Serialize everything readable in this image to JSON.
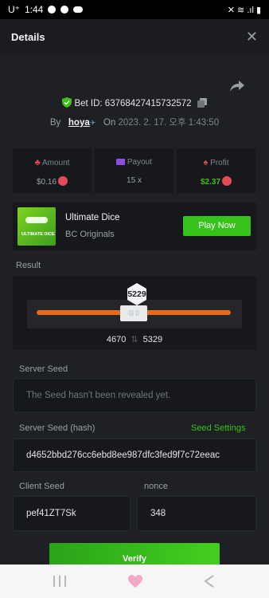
{
  "status_bar": {
    "carrier": "U⁺",
    "time": "1:44",
    "indicators": "✕ ≋ .ıl ▮"
  },
  "header": {
    "title": "Details",
    "close_icon": "close-icon"
  },
  "bet": {
    "id_label": "Bet ID: 63768427415732572",
    "by_label": "By",
    "user": "hoya",
    "on_label": "On",
    "date": "2023. 2. 17. 오후 1:43:50"
  },
  "stats": {
    "amount": {
      "label": "Amount",
      "value": "$0.16"
    },
    "payout": {
      "label": "Payout",
      "value": "15 x"
    },
    "profit": {
      "label": "Profit",
      "value": "$2.37"
    }
  },
  "game": {
    "name": "Ultimate Dice",
    "provider": "BC Originals",
    "thumb_text": "ULTIMATE DICE",
    "play_label": "Play Now"
  },
  "result": {
    "label": "Result",
    "roll": "5229",
    "range_low": "4670",
    "range_high": "5329",
    "handle_text": "⟨|| |⟩"
  },
  "server_seed": {
    "label": "Server Seed",
    "placeholder": "The Seed hasn't been revealed yet."
  },
  "server_seed_hash": {
    "label": "Server Seed (hash)",
    "settings_label": "Seed Settings",
    "value": "d4652bbd276cc6ebd8ee987dfc3fed9f7c72eeac"
  },
  "client_seed": {
    "label": "Client Seed",
    "value": "pef41ZT7Sk"
  },
  "nonce": {
    "label": "nonce",
    "value": "348"
  },
  "verify_label": "Verify",
  "colors": {
    "accent_green": "#37c21c",
    "result_orange": "#ea6a1c",
    "coin_red": "#e04b56",
    "background": "#1e2023",
    "panel": "#17181b"
  }
}
